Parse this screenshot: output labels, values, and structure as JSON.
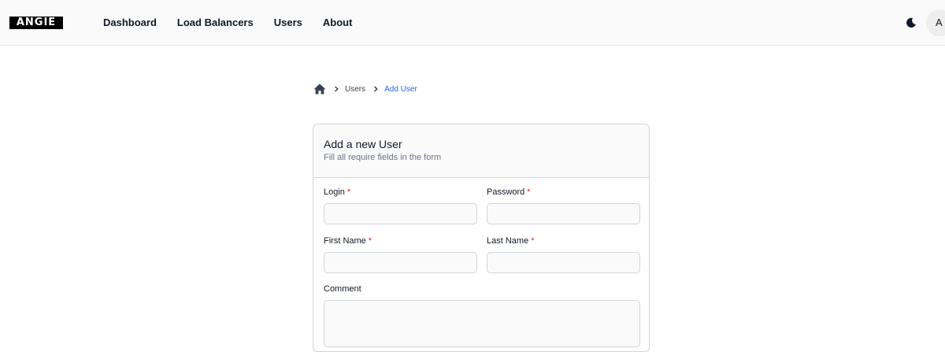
{
  "app": {
    "logo_text": "ANGIE",
    "avatar_initial": "A"
  },
  "nav": {
    "items": [
      {
        "label": "Dashboard"
      },
      {
        "label": "Load Balancers"
      },
      {
        "label": "Users"
      },
      {
        "label": "About"
      }
    ]
  },
  "header": {
    "theme_icon": "moon-icon"
  },
  "breadcrumb": {
    "home_icon": "home-icon",
    "items": [
      {
        "label": "Users"
      },
      {
        "label": "Add User"
      }
    ]
  },
  "form": {
    "title": "Add a new User",
    "subtitle": "Fill all require fields in the form",
    "required_marker": "*",
    "fields": {
      "login": {
        "label": "Login",
        "value": "",
        "placeholder": ""
      },
      "password": {
        "label": "Password",
        "value": "",
        "placeholder": ""
      },
      "first_name": {
        "label": "First Name",
        "value": "",
        "placeholder": ""
      },
      "last_name": {
        "label": "Last Name",
        "value": "",
        "placeholder": ""
      },
      "comment": {
        "label": "Comment",
        "value": "",
        "placeholder": ""
      }
    }
  },
  "colors": {
    "accent": "#2563eb",
    "required": "#dc2626",
    "border": "#d1d5db"
  }
}
